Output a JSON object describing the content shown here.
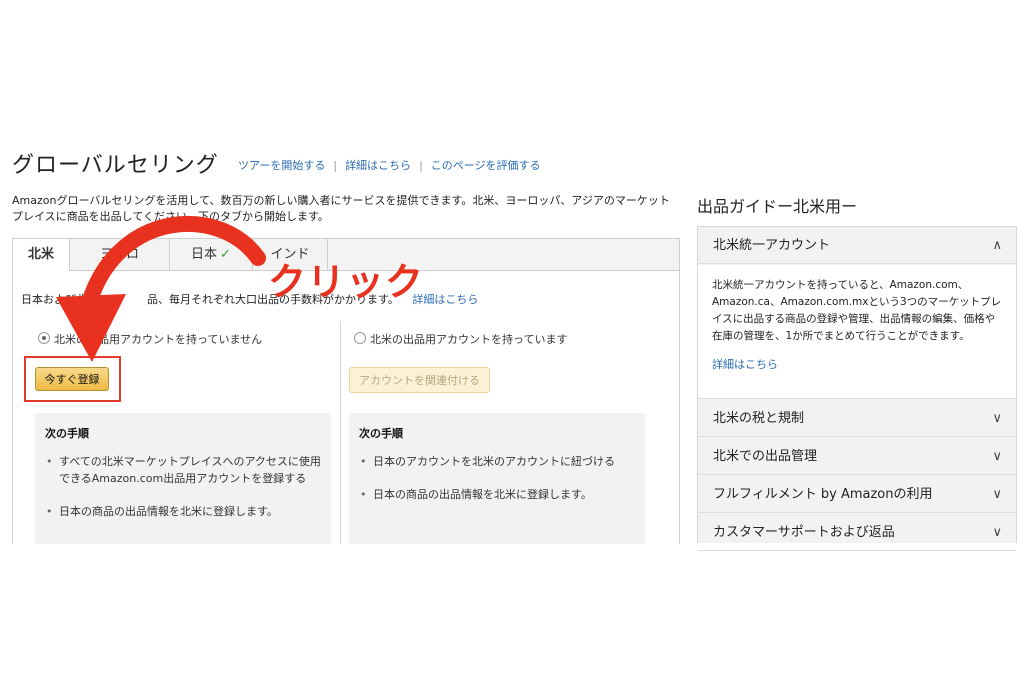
{
  "header": {
    "title": "グローバルセリング",
    "links": [
      "ツアーを開始する",
      "詳細はこちら",
      "このページを評価する"
    ],
    "separator": "|"
  },
  "intro_line1": "Amazonグローバルセリングを活用して、数百万の新しい購入者にサービスを提供できます。北米、ヨーロッパ、アジアのマーケット",
  "intro_line2": "プレイスに商品を出品してください。下のタブから開始します。",
  "tabs": [
    {
      "label": "北米",
      "active": true
    },
    {
      "label": "ヨーロ",
      "active": false
    },
    {
      "label": "日本",
      "active": false,
      "check": "✓"
    },
    {
      "label": "インド",
      "active": false
    }
  ],
  "fee_note": {
    "part1": "日本および北米で",
    "part2": "品",
    "part3": "毎月それぞれ大口出品の手数料がかかります。",
    "link": "詳細はこちら"
  },
  "left_option": {
    "radio_label": "北米の出品用アカウントを持っていません",
    "button": "今すぐ登録",
    "steps_title": "次の手順",
    "steps": [
      "すべての北米マーケットプレイスへのアクセスに使用できるAmazon.com出品用アカウントを登録する",
      "日本の商品の出品情報を北米に登録します。"
    ]
  },
  "right_option": {
    "radio_label": "北米の出品用アカウントを持っています",
    "button": "アカウントを関連付ける",
    "steps_title": "次の手順",
    "steps": [
      "日本のアカウントを北米のアカウントに紐づける",
      "日本の商品の出品情報を北米に登録します。"
    ]
  },
  "annotation": {
    "label": "クリック",
    "color": "#e8321f"
  },
  "guide": {
    "title": "出品ガイドー北米用ー",
    "sections": [
      {
        "label": "北米統一アカウント",
        "expanded": true,
        "icon": "chevron-up-icon"
      },
      {
        "label": "北米の税と規制",
        "expanded": false,
        "icon": "chevron-down-icon"
      },
      {
        "label": "北米での出品管理",
        "expanded": false,
        "icon": "chevron-down-icon"
      },
      {
        "label": "フルフィルメント by Amazonの利用",
        "expanded": false,
        "icon": "chevron-down-icon"
      },
      {
        "label": "カスタマーサポートおよび返品",
        "expanded": false,
        "icon": "chevron-down-icon"
      }
    ],
    "expanded_text": "北米統一アカウントを持っていると、Amazon.com、Amazon.ca、Amazon.com.mxという3つのマーケットプレイスに出品する商品の登録や管理、出品情報の編集、価格や在庫の管理を、1か所でまとめて行うことができます。",
    "expanded_link": "詳細はこちら"
  },
  "colors": {
    "link": "#2a6cb5",
    "button": "#efba44",
    "highlight": "#e53a2a"
  }
}
